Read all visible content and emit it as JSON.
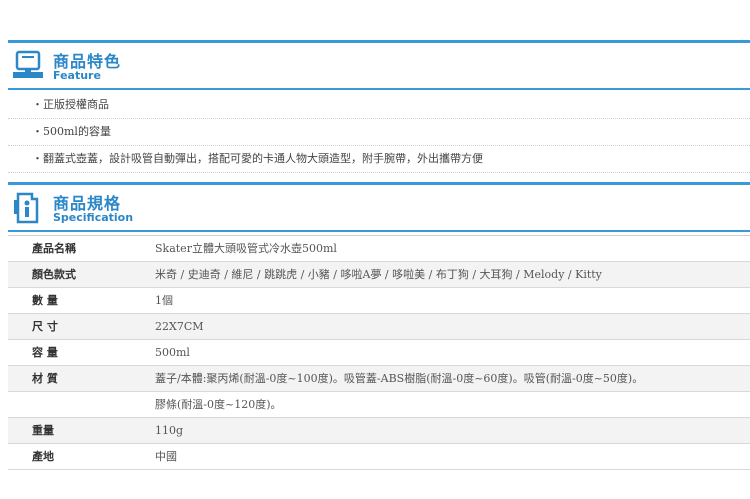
{
  "feature": {
    "title_zh": "商品特色",
    "title_en": "Feature",
    "items": [
      "・正版授權商品",
      "・500ml的容量",
      "・翻蓋式壺蓋，設計吸管自動彈出，搭配可愛的卡通人物大頭造型，附手腕帶，外出攜帶方便"
    ]
  },
  "spec": {
    "title_zh": "商品規格",
    "title_en": "Specification",
    "rows": [
      {
        "label": "產品名稱",
        "value": "Skater立體大頭吸管式冷水壺500ml"
      },
      {
        "label": "顏色款式",
        "value": "米奇 / 史迪奇 / 維尼 / 跳跳虎 / 小豬 / 哆啦A夢 / 哆啦美 / 布丁狗 / 大耳狗 / Melody / Kitty"
      },
      {
        "label": "數 量",
        "value": "1個"
      },
      {
        "label": "尺 寸",
        "value": "22X7CM"
      },
      {
        "label": "容 量",
        "value": "500ml"
      },
      {
        "label": "材 質",
        "value": "蓋子/本體:聚丙烯(耐溫-0度~100度)。吸管蓋-ABS樹脂(耐溫-0度~60度)。吸管(耐溫-0度~50度)。"
      },
      {
        "label": "",
        "value": "膠條(耐溫-0度~120度)。"
      },
      {
        "label": "重量",
        "value": "110g"
      },
      {
        "label": "產地",
        "value": "中國"
      }
    ]
  },
  "colors": {
    "accent": "#3a9ad9",
    "title": "#2a87c8"
  },
  "icons": {
    "feature": "computer-monitor-icon",
    "spec": "document-spec-icon"
  }
}
